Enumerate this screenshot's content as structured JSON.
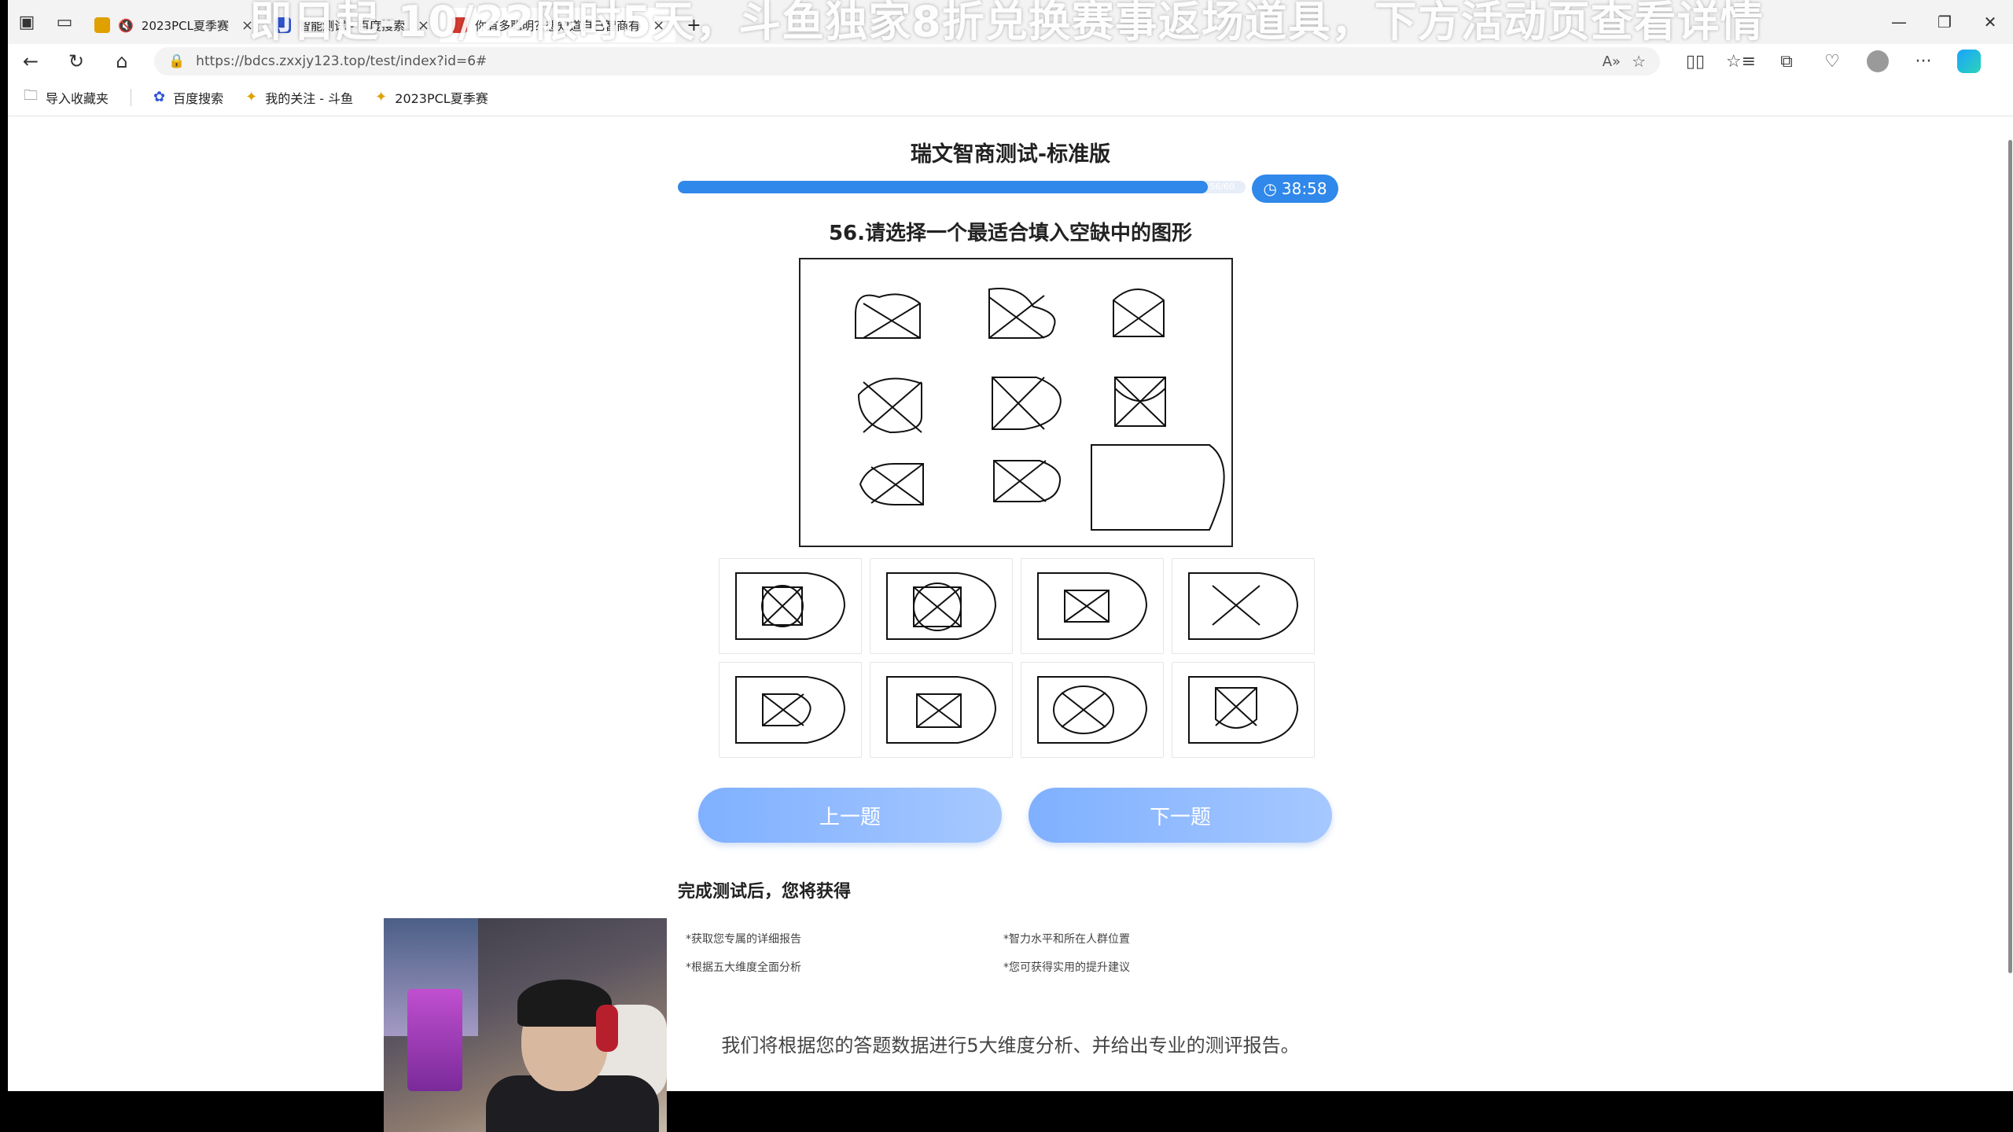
{
  "banner": "即日起-10/22限时5天，斗鱼独家8折兑换赛事返场道具，下方活动页查看详情",
  "tabs": [
    {
      "label": "2023PCL夏季赛",
      "favicon_color": "#e0a000",
      "active": false
    },
    {
      "label": "智能测试 - 百度搜索",
      "favicon_color": "#2f55d4",
      "active": false
    },
    {
      "label": "你有多聪明？想知道自己智商有",
      "favicon_color": "#d43a2f",
      "active": true
    }
  ],
  "new_tab": "+",
  "address": {
    "url": "https://bdcs.zxxjy123.top/test/index?id=6#"
  },
  "bookmarks": [
    {
      "label": "导入收藏夹",
      "icon": "folder-icon"
    },
    {
      "label": "百度搜索",
      "icon": "baidu-paw-icon"
    },
    {
      "label": "我的关注 - 斗鱼",
      "icon": "douyu-icon"
    },
    {
      "label": "2023PCL夏季赛",
      "icon": "douyu-icon"
    }
  ],
  "test": {
    "title": "瑞文智商测试-标准版",
    "progress_current": 56,
    "progress_total": 60,
    "progress_text": "56/60",
    "timer": "38:58",
    "question": "56.请选择一个最适合填入空缺中的图形"
  },
  "buttons": {
    "prev": "上一题",
    "next": "下一题"
  },
  "after": {
    "title": "完成测试后，您将获得",
    "benefits": [
      "*获取您专属的详细报告",
      "*智力水平和所在人群位置",
      "*根据五大维度全面分析",
      "*您可获得实用的提升建议"
    ],
    "summary": "我们将根据您的答题数据进行5大维度分析、并给出专业的测评报告。"
  },
  "colors": {
    "accent": "#2f88ea",
    "button_gradient_start": "#7fb0ff",
    "button_gradient_end": "#a6c8ff"
  }
}
